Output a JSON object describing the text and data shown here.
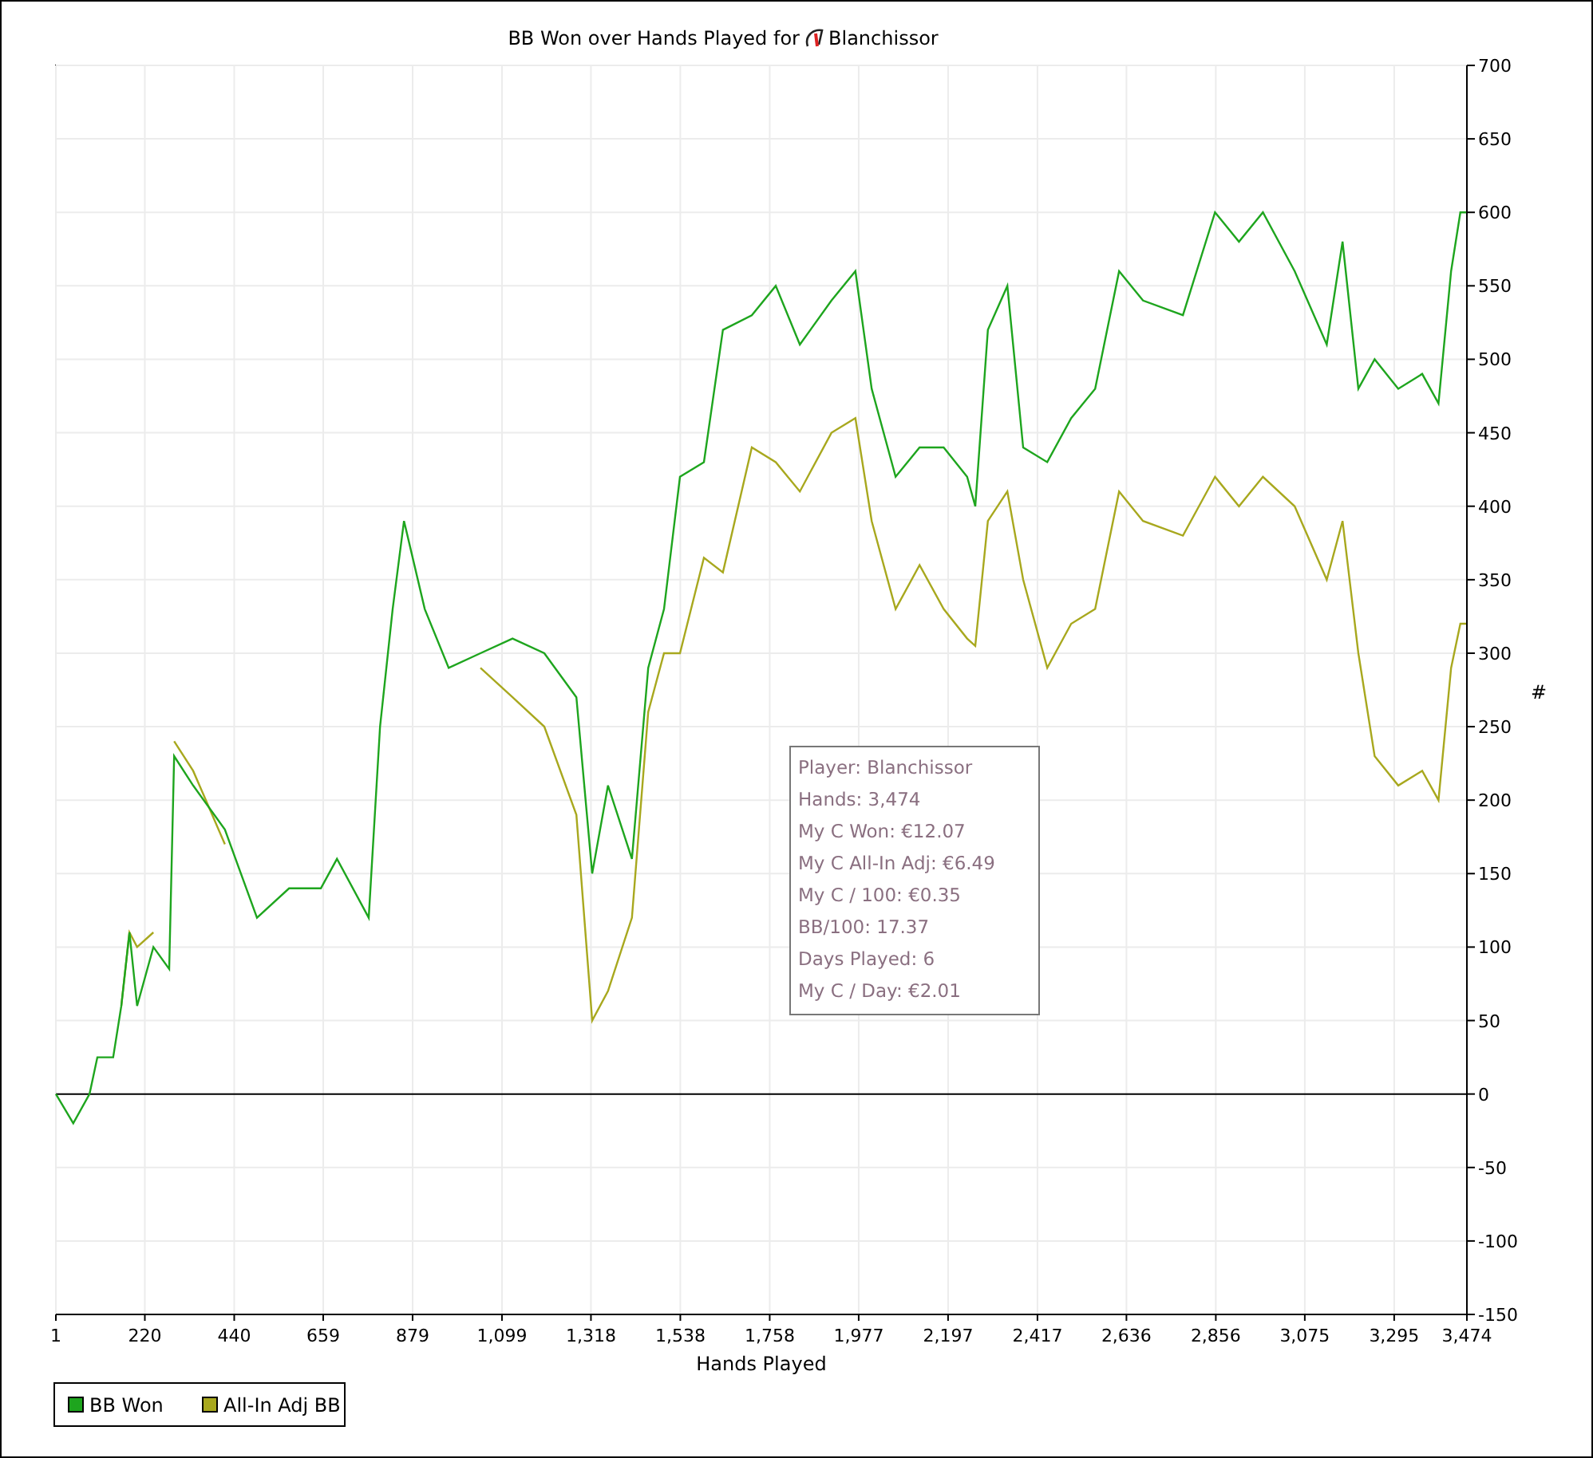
{
  "chart": {
    "title": "BB Won over Hands Played for",
    "player": "Blanchissor",
    "chart_data": {
      "type": "line",
      "xlabel": "Hands Played",
      "ylabel": "#",
      "x": [
        1,
        44,
        84,
        103,
        142,
        162,
        182,
        201,
        241,
        280,
        292,
        339,
        417,
        496,
        575,
        653,
        693,
        771,
        799,
        830,
        858,
        909,
        968,
        1046,
        1125,
        1203,
        1282,
        1321,
        1360,
        1419,
        1459,
        1498,
        1537,
        1596,
        1643,
        1714,
        1773,
        1832,
        1910,
        1969,
        2009,
        2068,
        2127,
        2186,
        2244,
        2264,
        2295,
        2343,
        2382,
        2441,
        2500,
        2559,
        2618,
        2677,
        2775,
        2854,
        2913,
        2972,
        3050,
        3129,
        3168,
        3207,
        3247,
        3305,
        3364,
        3404,
        3435,
        3458,
        3474
      ],
      "series": [
        {
          "name": "BB Won",
          "color": "#1ea51e",
          "values": [
            0,
            -20,
            0,
            25,
            25,
            60,
            110,
            60,
            100,
            85,
            230,
            210,
            180,
            120,
            140,
            140,
            160,
            120,
            250,
            330,
            390,
            330,
            290,
            300,
            310,
            300,
            270,
            150,
            210,
            160,
            290,
            330,
            420,
            430,
            520,
            530,
            550,
            510,
            540,
            560,
            480,
            420,
            440,
            440,
            420,
            400,
            520,
            550,
            440,
            430,
            460,
            480,
            560,
            540,
            530,
            600,
            580,
            600,
            560,
            510,
            580,
            480,
            500,
            480,
            490,
            470,
            560,
            600,
            600
          ]
        },
        {
          "name": "All-In Adj BB",
          "color": "#a8a81e",
          "values": [
            null,
            null,
            null,
            null,
            null,
            60,
            110,
            100,
            110,
            null,
            240,
            220,
            170,
            null,
            null,
            null,
            null,
            null,
            null,
            null,
            null,
            null,
            null,
            290,
            270,
            250,
            190,
            50,
            70,
            120,
            260,
            300,
            300,
            365,
            355,
            440,
            430,
            410,
            450,
            460,
            390,
            330,
            360,
            330,
            310,
            305,
            390,
            410,
            350,
            290,
            320,
            330,
            410,
            390,
            380,
            420,
            400,
            420,
            400,
            350,
            390,
            300,
            230,
            210,
            220,
            200,
            290,
            320,
            320
          ]
        }
      ],
      "xlim": [
        1,
        3474
      ],
      "ylim": [
        -150,
        700
      ],
      "xticks": [
        {
          "value": 1,
          "label": "1"
        },
        {
          "value": 220,
          "label": "220"
        },
        {
          "value": 440,
          "label": "440"
        },
        {
          "value": 659,
          "label": "659"
        },
        {
          "value": 879,
          "label": "879"
        },
        {
          "value": 1099,
          "label": "1,099"
        },
        {
          "value": 1318,
          "label": "1,318"
        },
        {
          "value": 1538,
          "label": "1,538"
        },
        {
          "value": 1758,
          "label": "1,758"
        },
        {
          "value": 1977,
          "label": "1,977"
        },
        {
          "value": 2197,
          "label": "2,197"
        },
        {
          "value": 2417,
          "label": "2,417"
        },
        {
          "value": 2636,
          "label": "2,636"
        },
        {
          "value": 2856,
          "label": "2,856"
        },
        {
          "value": 3075,
          "label": "3,075"
        },
        {
          "value": 3295,
          "label": "3,295"
        },
        {
          "value": 3474,
          "label": "3,474"
        }
      ],
      "yticks": [
        -150,
        -100,
        -50,
        0,
        50,
        100,
        150,
        200,
        250,
        300,
        350,
        400,
        450,
        500,
        550,
        600,
        650,
        700
      ],
      "grid": true,
      "legend": true
    },
    "tooltip": [
      "Player: Blanchissor",
      "Hands: 3,474",
      "My C Won: €12.07",
      "My C All-In Adj: €6.49",
      "My C / 100: €0.35",
      "BB/100: 17.37",
      "Days Played: 6",
      "My C / Day: €2.01"
    ]
  }
}
